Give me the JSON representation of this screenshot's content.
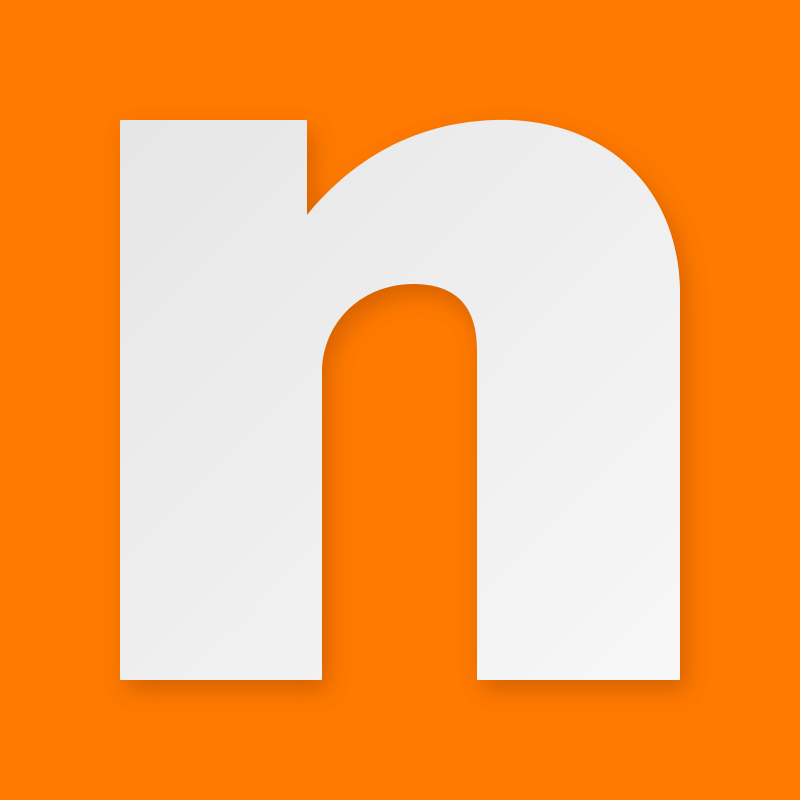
{
  "logo": {
    "letter": "n",
    "background_color": "#ff7a00",
    "glyph_color_light": "#f7f7f7",
    "glyph_color_dark": "#e6e6e6",
    "shadow_color": "#b34a00"
  }
}
